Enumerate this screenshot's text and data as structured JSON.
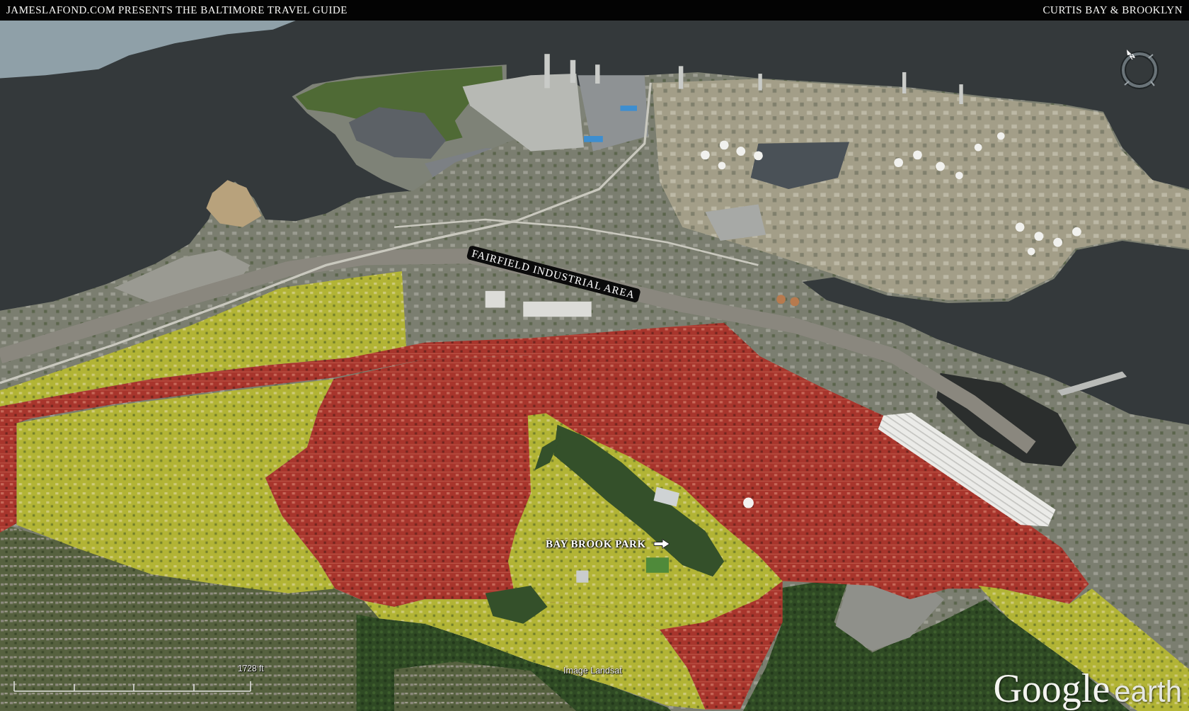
{
  "header": {
    "title": "JAMESLAFOND.COM PRESENTS THE BALTIMORE TRAVEL GUIDE",
    "location": "CURTIS BAY & BROOKLYN"
  },
  "map": {
    "labels": [
      {
        "kind": "banner",
        "text": "FAIRFIELD INDUSTRIAL AREA"
      },
      {
        "kind": "pointer",
        "text": "BAY BROOK PARK"
      }
    ],
    "compass": {
      "label": "N"
    },
    "scale": {
      "label": "1728 ft"
    },
    "attribution": "Image Landsat",
    "logo": {
      "brand": "Google",
      "product": "earth"
    }
  }
}
